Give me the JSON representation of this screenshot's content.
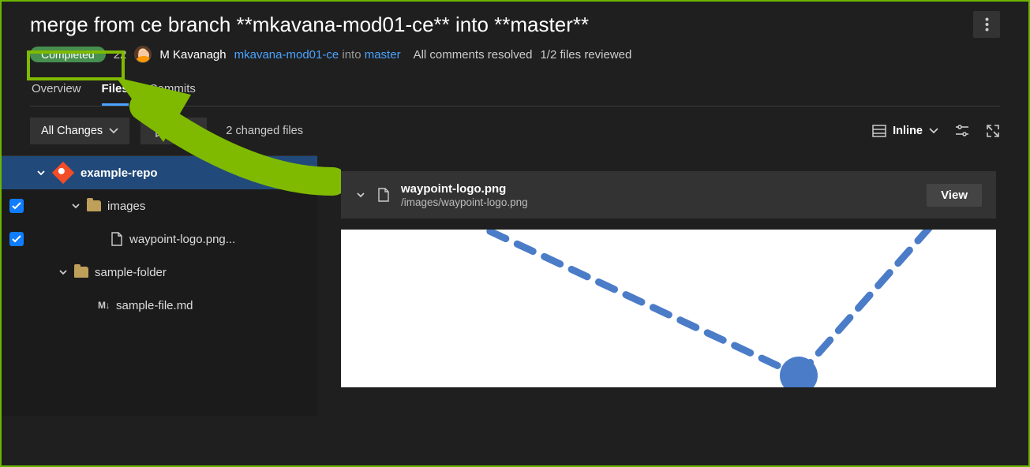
{
  "title": "merge from ce branch **mkavana-mod01-ce** into **master**",
  "status": {
    "label": "Completed"
  },
  "pr_number_fragment": "22",
  "author": "M Kavanagh",
  "source_branch": "mkavana-mod01-ce",
  "into_word": "into",
  "target_branch": "master",
  "comments_status": "All comments resolved",
  "files_reviewed": "1/2 files reviewed",
  "tabs": {
    "overview": "Overview",
    "files": "Files",
    "commits": "Commits"
  },
  "toolbar": {
    "all_changes": "All Changes",
    "filter": "Filter",
    "changed_files": "2 changed files",
    "inline": "Inline"
  },
  "tree": {
    "root": "example-repo",
    "folder1": "images",
    "file1": "waypoint-logo.png...",
    "folder2": "sample-folder",
    "file2": "sample-file.md",
    "md_glyph": "M↓"
  },
  "file": {
    "name": "waypoint-logo.png",
    "path": "/images/waypoint-logo.png",
    "view": "View"
  }
}
